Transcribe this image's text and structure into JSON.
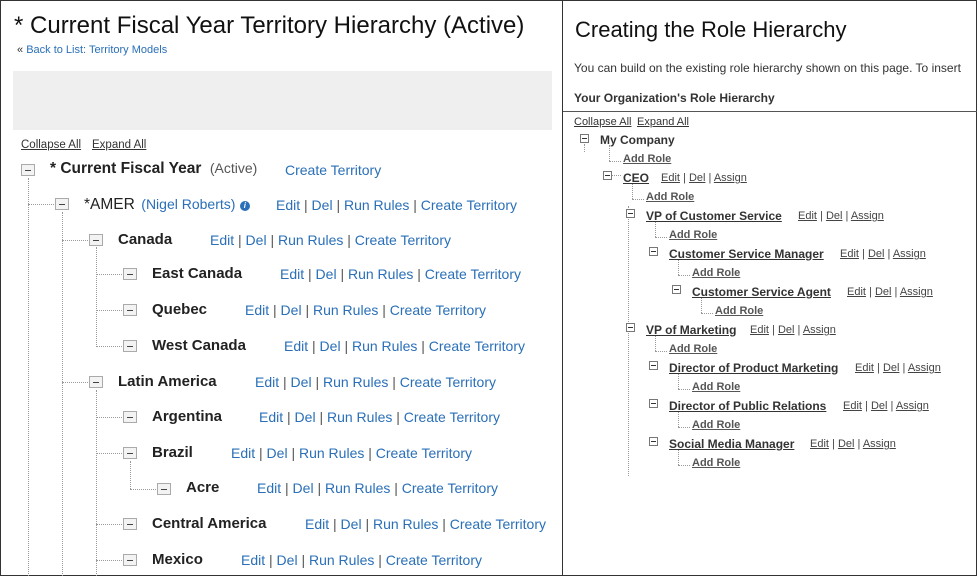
{
  "left": {
    "title": "* Current Fiscal Year Territory Hierarchy (Active)",
    "back_prefix": "«",
    "back_link": "Back to List: Territory Models",
    "collapse_all": "Collapse All",
    "expand_all": "Expand All",
    "root": {
      "label": "* Current Fiscal Year",
      "status": "(Active)",
      "action": "Create Territory"
    },
    "amer": {
      "label": "*AMER",
      "owner": "(Nigel Roberts)"
    },
    "territories": {
      "canada": "Canada",
      "east_canada": "East Canada",
      "quebec": "Quebec",
      "west_canada": "West Canada",
      "latin_america": "Latin America",
      "argentina": "Argentina",
      "brazil": "Brazil",
      "acre": "Acre",
      "central_america": "Central America",
      "mexico": "Mexico"
    },
    "actions": {
      "edit": "Edit",
      "del": "Del",
      "run_rules": "Run Rules",
      "create_territory": "Create Territory",
      "sep": "|"
    }
  },
  "right": {
    "title": "Creating the Role Hierarchy",
    "intro": "You can build on the existing role hierarchy shown on this page. To insert",
    "heading": "Your Organization's Role Hierarchy",
    "collapse_all": "Collapse All",
    "expand_all": "Expand All",
    "company": "My Company",
    "add_role": "Add Role",
    "roles": {
      "ceo": "CEO",
      "vp_customer_service": "VP of Customer Service",
      "customer_service_manager": "Customer Service Manager",
      "customer_service_agent": "Customer Service Agent",
      "vp_marketing": "VP of Marketing",
      "director_product_marketing": "Director of Product Marketing",
      "director_public_relations": "Director of Public Relations",
      "social_media_manager": "Social Media Manager"
    },
    "actions": {
      "edit": "Edit",
      "del": "Del",
      "assign": "Assign",
      "sep": "|"
    }
  }
}
